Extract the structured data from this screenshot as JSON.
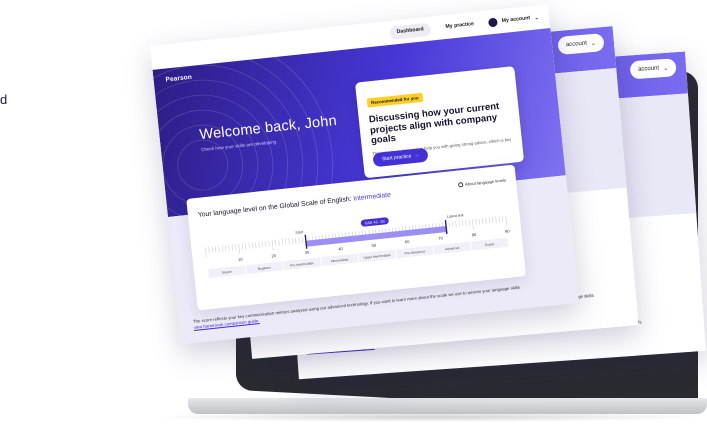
{
  "edge_glyph": "d",
  "back_cards": {
    "account_label": "account",
    "footer_text": "The score reflects your key communication metrics analyzed using our advanced technology. If you want to learn more about the scale we use to assess your language skills",
    "footer_link": "view framework comparison guide."
  },
  "brand": {
    "logo": "Pearson"
  },
  "nav": {
    "dashboard": "Dashboard",
    "practice": "My practice",
    "account": "My account"
  },
  "hero": {
    "welcome": "Welcome back, John",
    "subtitle": "Check how your skills are developing."
  },
  "recommendation": {
    "badge": "Recommended for you",
    "title": "Discussing how your current projects align with company goals",
    "description": "This roleplay is designed to help you with giving strong advice, which is key for your role.",
    "button": "Start practice"
  },
  "language_level": {
    "title": "Your language level on the Global Scale of English:",
    "level": "Intermediate",
    "about_link": "About language levels",
    "start_label": "Start",
    "latest_label": "Latest test",
    "range_label": "GSE 43 - 50",
    "ticks": [
      "10",
      "20",
      "30",
      "40",
      "50",
      "60",
      "70",
      "80",
      "90"
    ],
    "bands": [
      "Starter",
      "Beginner",
      "Pre-Intermediate",
      "Intermediate",
      "Upper Intermediate",
      "Pre-Advanced",
      "Advanced",
      "Expert"
    ],
    "start_value": 30,
    "latest_value": 72,
    "axis_min": 0,
    "axis_max": 90
  },
  "footer": {
    "text": "The score reflects your key communication metrics analyzed using our advanced technology. If you want to learn more about the scale we use to assess your language skills",
    "link": "view framework comparison guide."
  },
  "colors": {
    "brand_dark": "#2c1d85",
    "brand_accent": "#4637d6",
    "badge_yellow": "#ffcf28",
    "level_text": "#4b38e3"
  }
}
